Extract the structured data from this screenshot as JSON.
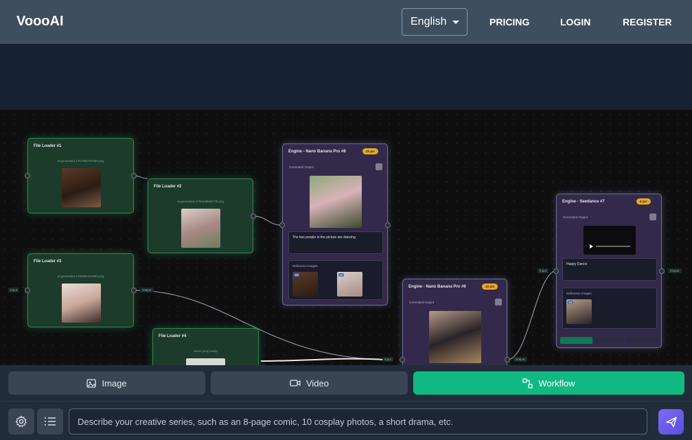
{
  "header": {
    "brand": "VoooAI",
    "language": "English",
    "nav": [
      "PRICING",
      "LOGIN",
      "REGISTER"
    ]
  },
  "canvas": {
    "loaders": [
      {
        "title": "File Loader #1",
        "file": "ai-generated-1767866797504.png"
      },
      {
        "title": "File Loader #2",
        "file": "ai-generated-1766448656178.png"
      },
      {
        "title": "File Loader #3",
        "file": "ai-generated-1766484431980.png"
      },
      {
        "title": "File Loader #4",
        "file": "dress (eep).webp"
      }
    ],
    "engine8": {
      "title": "Engine - Nano Banana Pro #8",
      "badge": "30 pts",
      "generated_label": "Generated Output",
      "prompt": "The two people in the picture are dancing",
      "refs_label": "Reference Images",
      "refs": [
        "#1",
        "#2"
      ]
    },
    "engine9": {
      "title": "Engine - Nano Banana Pro #9",
      "badge": "30 pts",
      "generated_label": "Generated Output"
    },
    "engine7": {
      "title": "Engine - Seedance #7",
      "badge": "8 pts",
      "generated_label": "Generated Output",
      "prompt": "Happy Dance",
      "refs_label": "Reference Images",
      "refs": [
        "#1"
      ]
    },
    "port_input": "Input",
    "port_output": "Output"
  },
  "tabs": [
    {
      "label": "Image",
      "icon": "image-icon"
    },
    {
      "label": "Video",
      "icon": "video-icon"
    },
    {
      "label": "Workflow",
      "icon": "workflow-icon",
      "active": true
    }
  ],
  "composer": {
    "placeholder": "Describe your creative series, such as an 8-page comic, 10 cosplay photos, a short drama, etc."
  },
  "colors": {
    "accent": "#10b981",
    "send": "#6b5cf0",
    "header": "#3f4e5e"
  }
}
